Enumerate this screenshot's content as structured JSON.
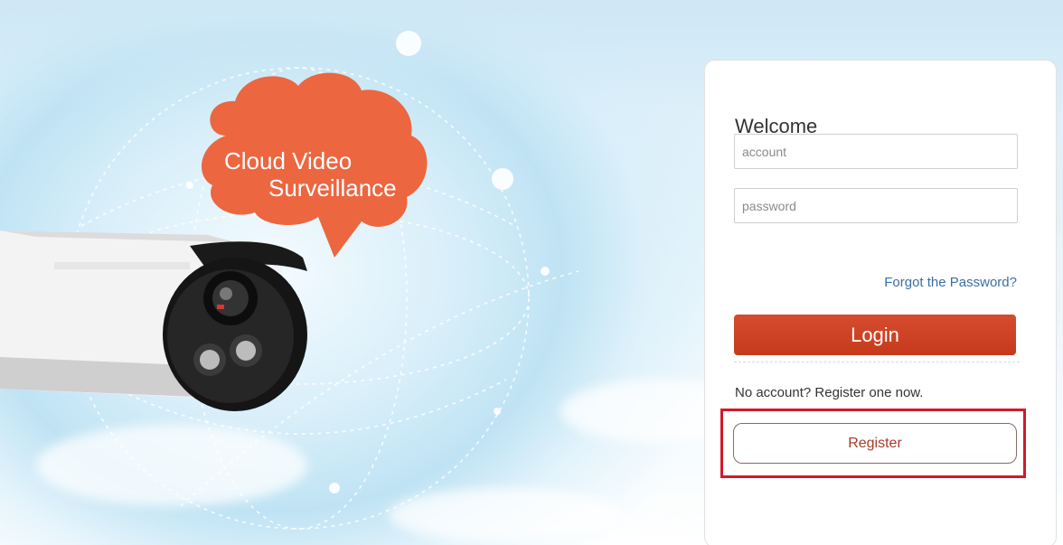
{
  "banner": {
    "bubble_line1": "Cloud Video",
    "bubble_line2": "Surveillance"
  },
  "login": {
    "welcome": "Welcome",
    "account_placeholder": "account",
    "password_placeholder": "password",
    "forgot_label": "Forgot the Password?",
    "login_label": "Login",
    "no_account_text": "No account? Register one now.",
    "register_label": "Register"
  },
  "colors": {
    "accent": "#c8401f",
    "link": "#3a6ea5",
    "highlight": "#d11a2a"
  }
}
